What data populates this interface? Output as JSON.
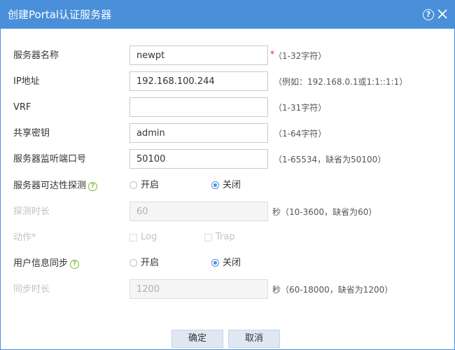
{
  "title": "创建Portal认证服务器",
  "help_glyph": "?",
  "fields": {
    "server_name": {
      "label": "服务器名称",
      "value": "newpt",
      "required": "*",
      "hint": "（1-32字符）"
    },
    "ip": {
      "label": "IP地址",
      "value": "192.168.100.244",
      "hint": "（例如：192.168.0.1或1:1::1:1）"
    },
    "vrf": {
      "label": "VRF",
      "value": "",
      "hint": "（1-31字符）"
    },
    "shared_key": {
      "label": "共享密钥",
      "value": "admin",
      "hint": "（1-64字符）"
    },
    "listen_port": {
      "label": "服务器监听端口号",
      "value": "50100",
      "hint": "（1-65534，缺省为50100）"
    },
    "reachability": {
      "label": "服务器可达性探测",
      "help": "?",
      "options": [
        "开启",
        "关闭"
      ],
      "selected": "关闭"
    },
    "probe_duration": {
      "label": "探测时长",
      "value": "60",
      "hint": "秒（10-3600，缺省为60）"
    },
    "action": {
      "label": "动作*",
      "options": [
        "Log",
        "Trap"
      ]
    },
    "user_sync": {
      "label": "用户信息同步",
      "help": "?",
      "options": [
        "开启",
        "关闭"
      ],
      "selected": "关闭"
    },
    "sync_duration": {
      "label": "同步时长",
      "value": "1200",
      "hint": "秒（60-18000，缺省为1200）"
    }
  },
  "buttons": {
    "ok": "确定",
    "cancel": "取消"
  },
  "colors": {
    "accent": "#4a8fd9",
    "required": "#e02020",
    "help_green": "#7cbb3a"
  }
}
